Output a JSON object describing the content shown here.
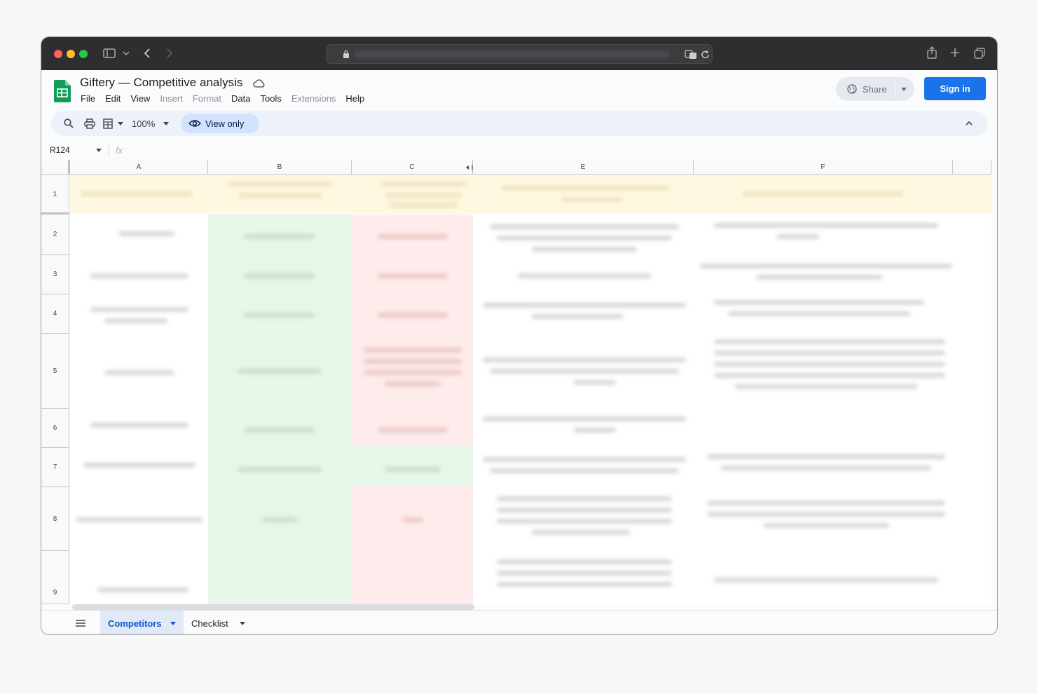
{
  "browser": {
    "icons": [
      "sidebar-icon",
      "chevron-down-icon",
      "back-icon",
      "forward-icon",
      "lock-icon",
      "translate-icon",
      "reload-icon",
      "share-icon",
      "new-tab-icon",
      "tabs-overview-icon"
    ]
  },
  "sheet": {
    "title": "Giftery — Competitive analysis",
    "menu": [
      "File",
      "Edit",
      "View",
      "Insert",
      "Format",
      "Data",
      "Tools",
      "Extensions",
      "Help"
    ],
    "share_label": "Share",
    "signin_label": "Sign in",
    "zoom": "100%",
    "view_only_label": "View only",
    "cell_ref": "R124",
    "fx_label": "fx",
    "columns": [
      "A",
      "B",
      "C",
      "E",
      "F"
    ],
    "rows": [
      "1",
      "2",
      "3",
      "4",
      "5",
      "6",
      "7",
      "8",
      "9"
    ],
    "tabs": [
      "Competitors",
      "Checklist"
    ]
  },
  "colors": {
    "accent": "#1a73e8",
    "header_fill": "#fff8e1",
    "positive_fill": "#e6f4e8",
    "negative_fill": "#fdeceb"
  }
}
